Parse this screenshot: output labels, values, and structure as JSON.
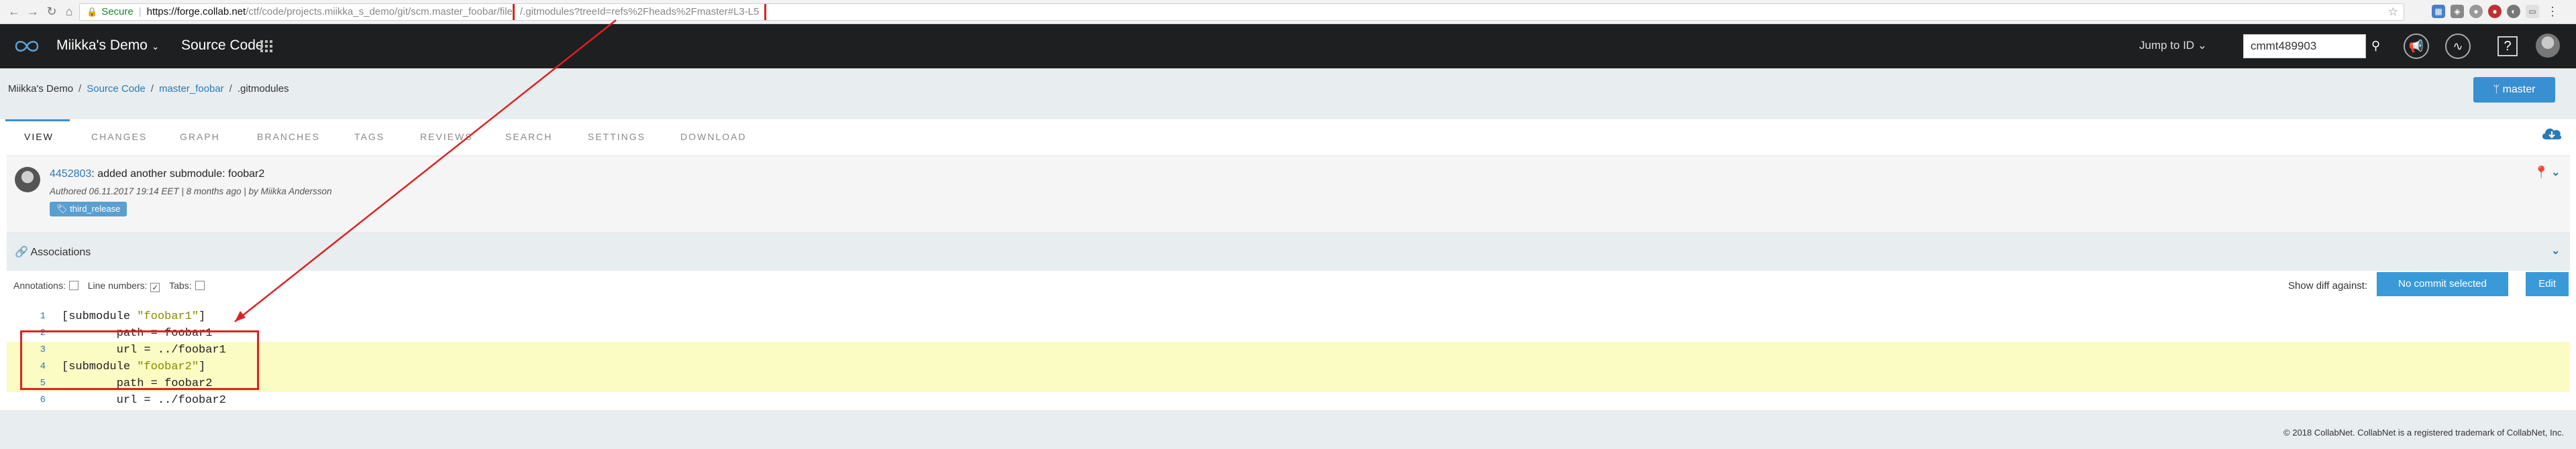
{
  "browser": {
    "secure_label": "Secure",
    "url_host": "https://forge.collab.net",
    "url_path": "/ctf/code/projects.miikka_s_demo/git/scm.master_foobar/file",
    "url_highlight": "/.gitmodules?treeId=refs%2Fheads%2Fmaster#L3-L5"
  },
  "header": {
    "project": "Miikka's Demo",
    "section": "Source Code",
    "jump_label": "Jump to ID",
    "search_value": "cmmt489903",
    "help_label": "?"
  },
  "breadcrumb": {
    "items": [
      "Miikka's Demo",
      "Source Code",
      "master_foobar",
      ".gitmodules"
    ]
  },
  "branch_button": "master",
  "tabs": [
    "VIEW",
    "CHANGES",
    "GRAPH",
    "BRANCHES",
    "TAGS",
    "REVIEWS",
    "SEARCH",
    "SETTINGS",
    "DOWNLOAD"
  ],
  "commit": {
    "id": "4452803",
    "message": ": added another submodule: foobar2",
    "meta": "Authored  06.11.2017 19:14 EET | 8 months ago | by Miikka Andersson",
    "tag": "third_release"
  },
  "associations_title": "Associations",
  "toolbar": {
    "annotations": "Annotations:",
    "line_numbers": "Line numbers:",
    "tabs": "Tabs:",
    "show_diff": "Show diff against:",
    "no_commit": "No commit selected",
    "edit": "Edit"
  },
  "code": [
    {
      "n": "1",
      "a": "[submodule ",
      "s": "\"foobar1\"",
      "b": "]"
    },
    {
      "n": "2",
      "a": "        path = foobar1",
      "s": "",
      "b": ""
    },
    {
      "n": "3",
      "a": "        url = ../foobar1",
      "s": "",
      "b": ""
    },
    {
      "n": "4",
      "a": "[submodule ",
      "s": "\"foobar2\"",
      "b": "]"
    },
    {
      "n": "5",
      "a": "        path = foobar2",
      "s": "",
      "b": ""
    },
    {
      "n": "6",
      "a": "        url = ../foobar2",
      "s": "",
      "b": ""
    }
  ],
  "highlighted_lines": [
    3,
    4,
    5
  ],
  "footer": "© 2018 CollabNet. CollabNet is a registered trademark of CollabNet, Inc.",
  "colors": {
    "accent": "#3a8fd0",
    "annotation": "#e02020",
    "highlight": "#fbfbc4",
    "header_bg": "#1d1f20"
  }
}
